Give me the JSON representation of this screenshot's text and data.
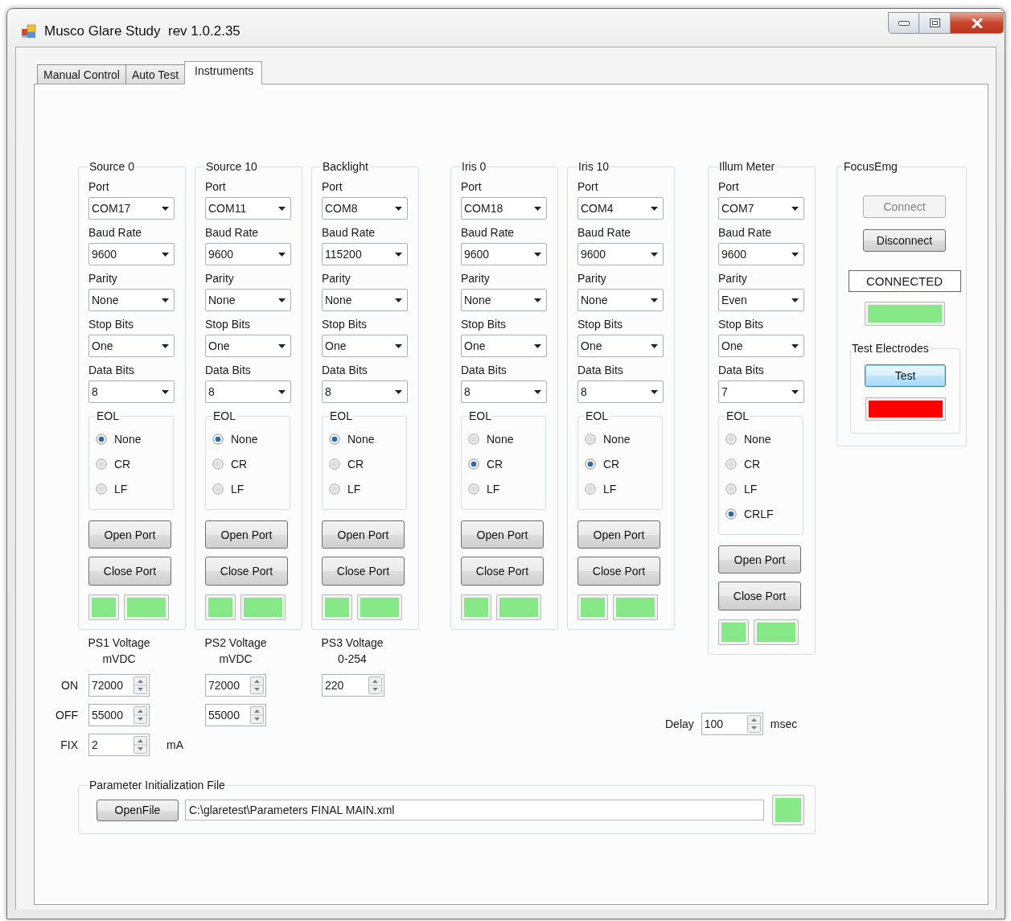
{
  "window": {
    "title": "Musco Glare Study  rev 1.0.2.35"
  },
  "tabs": [
    {
      "label": "Manual Control",
      "selected": false
    },
    {
      "label": "Auto Test",
      "selected": false
    },
    {
      "label": "Instruments",
      "selected": true
    }
  ],
  "serial_ports": [
    {
      "title": "Source 0",
      "fields": [
        {
          "label": "Port",
          "value": "COM17"
        },
        {
          "label": "Baud Rate",
          "value": "9600"
        },
        {
          "label": "Parity",
          "value": "None"
        },
        {
          "label": "Stop Bits",
          "value": "One"
        },
        {
          "label": "Data Bits",
          "value": "8"
        }
      ],
      "eol": {
        "title": "EOL",
        "options": [
          {
            "label": "None",
            "selected": true
          },
          {
            "label": "CR",
            "selected": false
          },
          {
            "label": "LF",
            "selected": false
          }
        ]
      },
      "buttons": [
        "Open Port",
        "Close Port"
      ],
      "indicators": [
        {
          "color": "#86e886"
        },
        {
          "color": "#86e886"
        }
      ]
    },
    {
      "title": "Source 10",
      "fields": [
        {
          "label": "Port",
          "value": "COM11"
        },
        {
          "label": "Baud Rate",
          "value": "9600"
        },
        {
          "label": "Parity",
          "value": "None"
        },
        {
          "label": "Stop Bits",
          "value": "One"
        },
        {
          "label": "Data Bits",
          "value": "8"
        }
      ],
      "eol": {
        "title": "EOL",
        "options": [
          {
            "label": "None",
            "selected": true
          },
          {
            "label": "CR",
            "selected": false
          },
          {
            "label": "LF",
            "selected": false
          }
        ]
      },
      "buttons": [
        "Open Port",
        "Close Port"
      ],
      "indicators": [
        {
          "color": "#86e886"
        },
        {
          "color": "#86e886"
        }
      ]
    },
    {
      "title": "Backlight",
      "fields": [
        {
          "label": "Port",
          "value": "COM8"
        },
        {
          "label": "Baud Rate",
          "value": "115200"
        },
        {
          "label": "Parity",
          "value": "None"
        },
        {
          "label": "Stop Bits",
          "value": "One"
        },
        {
          "label": "Data Bits",
          "value": "8"
        }
      ],
      "eol": {
        "title": "EOL",
        "options": [
          {
            "label": "None",
            "selected": true
          },
          {
            "label": "CR",
            "selected": false
          },
          {
            "label": "LF",
            "selected": false
          }
        ]
      },
      "buttons": [
        "Open Port",
        "Close Port"
      ],
      "indicators": [
        {
          "color": "#86e886"
        },
        {
          "color": "#86e886"
        }
      ]
    },
    {
      "title": "Iris 0",
      "fields": [
        {
          "label": "Port",
          "value": "COM18"
        },
        {
          "label": "Baud Rate",
          "value": "9600"
        },
        {
          "label": "Parity",
          "value": "None"
        },
        {
          "label": "Stop Bits",
          "value": "One"
        },
        {
          "label": "Data Bits",
          "value": "8"
        }
      ],
      "eol": {
        "title": "EOL",
        "options": [
          {
            "label": "None",
            "selected": false
          },
          {
            "label": "CR",
            "selected": true
          },
          {
            "label": "LF",
            "selected": false
          }
        ]
      },
      "buttons": [
        "Open Port",
        "Close Port"
      ],
      "indicators": [
        {
          "color": "#86e886"
        },
        {
          "color": "#86e886"
        }
      ]
    },
    {
      "title": "Iris 10",
      "fields": [
        {
          "label": "Port",
          "value": "COM4"
        },
        {
          "label": "Baud Rate",
          "value": "9600"
        },
        {
          "label": "Parity",
          "value": "None"
        },
        {
          "label": "Stop Bits",
          "value": "One"
        },
        {
          "label": "Data Bits",
          "value": "8"
        }
      ],
      "eol": {
        "title": "EOL",
        "options": [
          {
            "label": "None",
            "selected": false
          },
          {
            "label": "CR",
            "selected": true
          },
          {
            "label": "LF",
            "selected": false
          }
        ]
      },
      "buttons": [
        "Open Port",
        "Close Port"
      ],
      "indicators": [
        {
          "color": "#86e886"
        },
        {
          "color": "#86e886"
        }
      ]
    },
    {
      "title": "Illum Meter",
      "fields": [
        {
          "label": "Port",
          "value": "COM7"
        },
        {
          "label": "Baud Rate",
          "value": "9600"
        },
        {
          "label": "Parity",
          "value": "Even"
        },
        {
          "label": "Stop Bits",
          "value": "One"
        },
        {
          "label": "Data Bits",
          "value": "7"
        }
      ],
      "eol": {
        "title": "EOL",
        "options": [
          {
            "label": "None",
            "selected": false
          },
          {
            "label": "CR",
            "selected": false
          },
          {
            "label": "LF",
            "selected": false
          },
          {
            "label": "CRLF",
            "selected": true
          }
        ]
      },
      "buttons": [
        "Open Port",
        "Close Port"
      ],
      "indicators": [
        {
          "color": "#86e886"
        },
        {
          "color": "#86e886"
        }
      ]
    }
  ],
  "power_supplies": {
    "headings": [
      {
        "title": "PS1 Voltage",
        "unit": "mVDC"
      },
      {
        "title": "PS2 Voltage",
        "unit": "mVDC"
      },
      {
        "title": "PS3 Voltage",
        "unit": "0-254"
      }
    ],
    "rows": [
      {
        "label": "ON",
        "values": [
          "72000",
          "72000",
          "220"
        ]
      },
      {
        "label": "OFF",
        "values": [
          "55000",
          "55000"
        ]
      },
      {
        "label": "FIX",
        "values": [
          "2"
        ],
        "unit": "mA"
      }
    ]
  },
  "delay": {
    "label": "Delay",
    "value": "100",
    "unit": "msec"
  },
  "focus_emg": {
    "title": "FocusEmg",
    "buttons": [
      {
        "label": "Connect",
        "disabled": true
      },
      {
        "label": "Disconnect",
        "disabled": false
      }
    ],
    "status": "CONNECTED",
    "status_indicator": {
      "color": "#86e886"
    },
    "test_electrodes": {
      "title": "Test Electrodes",
      "button": {
        "label": "Test",
        "focused": true
      },
      "indicator": {
        "color": "#ff0000"
      }
    }
  },
  "parameter_file": {
    "title": "Parameter Initialization File",
    "button": "OpenFile",
    "path": "C:\\glaretest\\Parameters FINAL MAIN.xml",
    "indicator": {
      "color": "#86e886"
    }
  }
}
